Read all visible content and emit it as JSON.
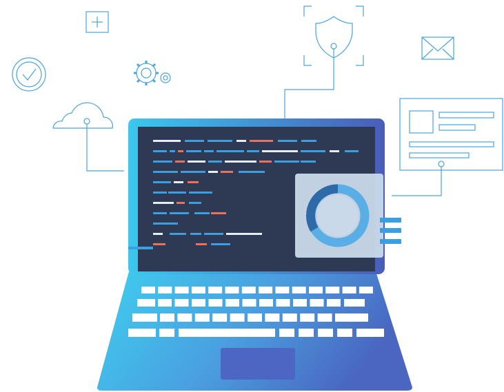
{
  "colors": {
    "line": "#4aa3d9",
    "laptop_light": "#3cc8ee",
    "laptop_dark": "#4a5db8",
    "screen": "#2e3a54",
    "code_blue": "#3a9fe0",
    "code_orange": "#e8735a",
    "code_white": "#e8edf3",
    "donut_dark": "#2f6aa8",
    "donut_light": "#5aaee6",
    "panel": "#c8d8ea",
    "keys": "#ffffff"
  },
  "icons": {
    "plus": "plus-icon",
    "check": "check-circle-icon",
    "gear": "gear-icon",
    "cloud": "cloud-icon",
    "shield": "shield-icon",
    "mail": "mail-icon",
    "document": "document-window-icon",
    "donut": "donut-chart-icon",
    "laptop": "laptop-icon"
  }
}
